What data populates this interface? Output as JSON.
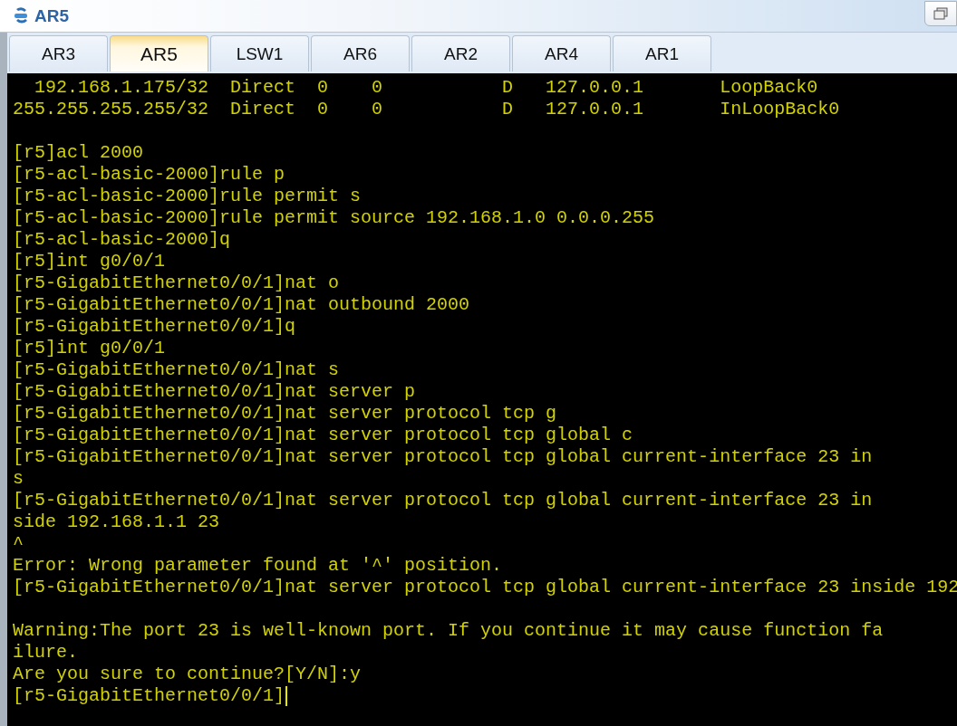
{
  "window": {
    "title": "AR5"
  },
  "tabs": [
    {
      "label": "AR3",
      "selected": false
    },
    {
      "label": "AR5",
      "selected": true
    },
    {
      "label": "LSW1",
      "selected": false
    },
    {
      "label": "AR6",
      "selected": false
    },
    {
      "label": "AR2",
      "selected": false
    },
    {
      "label": "AR4",
      "selected": false
    },
    {
      "label": "AR1",
      "selected": false
    }
  ],
  "terminal": {
    "lines": [
      {
        "text": "  192.168.1.175/32  Direct  0    0           D   127.0.0.1       LoopBack0"
      },
      {
        "text": "255.255.255.255/32  Direct  0    0           D   127.0.0.1       InLoopBack0"
      },
      {
        "text": "[r5]acl 2000",
        "blank_before": true
      },
      {
        "text": "[r5-acl-basic-2000]rule p"
      },
      {
        "text": "[r5-acl-basic-2000]rule permit s"
      },
      {
        "text": "[r5-acl-basic-2000]rule permit source 192.168.1.0 0.0.0.255"
      },
      {
        "text": "[r5-acl-basic-2000]q"
      },
      {
        "text": "[r5]int g0/0/1"
      },
      {
        "text": "[r5-GigabitEthernet0/0/1]nat o"
      },
      {
        "text": "[r5-GigabitEthernet0/0/1]nat outbound 2000"
      },
      {
        "text": "[r5-GigabitEthernet0/0/1]q"
      },
      {
        "text": "[r5]int g0/0/1"
      },
      {
        "text": "[r5-GigabitEthernet0/0/1]nat s"
      },
      {
        "text": "[r5-GigabitEthernet0/0/1]nat server p"
      },
      {
        "text": "[r5-GigabitEthernet0/0/1]nat server protocol tcp g"
      },
      {
        "text": "[r5-GigabitEthernet0/0/1]nat server protocol tcp global c"
      },
      {
        "text": "[r5-GigabitEthernet0/0/1]nat server protocol tcp global current-interface 23 in"
      },
      {
        "text": "s"
      },
      {
        "text": "[r5-GigabitEthernet0/0/1]nat server protocol tcp global current-interface 23 in"
      },
      {
        "text": "side 192.168.1.1 23"
      },
      {
        "text": "^"
      },
      {
        "text": "Error: Wrong parameter found at '^' position."
      },
      {
        "text": "[r5-GigabitEthernet0/0/1]nat server protocol tcp global current-interface 23 inside 192"
      },
      {
        "text": "Warning:The port 23 is well-known port. If you continue it may cause function fa",
        "blank_before": true
      },
      {
        "text": "ilure."
      },
      {
        "text": "Are you sure to continue?[Y/N]:y"
      },
      {
        "text": "[r5-GigabitEthernet0/0/1]",
        "cursor": true
      }
    ]
  }
}
